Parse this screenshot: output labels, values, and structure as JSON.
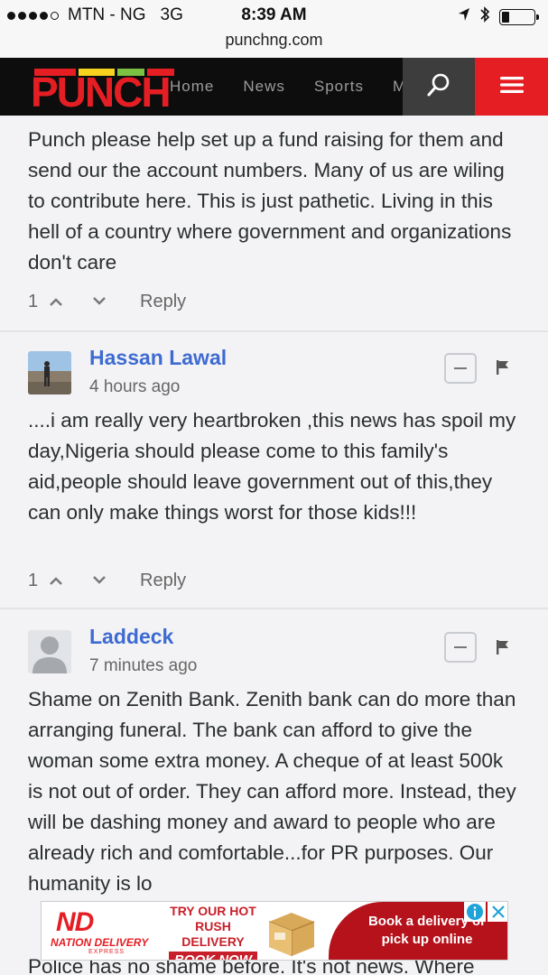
{
  "status_bar": {
    "carrier": "MTN - NG",
    "network": "3G",
    "time": "8:39 AM",
    "signal_bars": 4,
    "battery_level": 0.25
  },
  "url": "punchng.com",
  "site": {
    "logo_text": "PUNCH",
    "nav": [
      "Home",
      "News",
      "Sports",
      "M"
    ],
    "search_icon": "search-icon",
    "menu_icon": "hamburger-menu-icon",
    "logo_colors": [
      "#e51e24",
      "#f7d21e",
      "#7cc242",
      "#e51e24"
    ]
  },
  "comments": [
    {
      "text": "Punch please help set up a fund raising for them and send our the account numbers. Many of us are wiling to contribute here. This is just pathetic. Living in this hell of a country where government and organizations don't care",
      "votes": "1",
      "reply": "Reply"
    },
    {
      "author": "Hassan Lawal",
      "time": "4 hours ago",
      "text": "....i am really very heartbroken ,this news has spoil my day,Nigeria should please come to this family's aid,people should leave government out of this,they can only make things worst for those kids!!!",
      "votes": "1",
      "reply": "Reply"
    },
    {
      "author": "Laddeck",
      "time": "7 minutes ago",
      "text": "Shame on Zenith Bank. Zenith bank can do more than arranging funeral. The bank can afford to give the woman some extra money. A cheque of at least 500k is not out of order. They can afford more. Instead, they will be dashing money and award to people who are already rich and comfortable...for PR purposes. Our humanity is lo"
    },
    {
      "text": "Police has no shame before. It's not news. Where"
    }
  ],
  "ad": {
    "brand_mark": "ND",
    "brand_name": "NATION DELIVERY",
    "brand_sub": "EXPRESS",
    "line1": "TRY OUR HOT",
    "line2": "RUSH DELIVERY",
    "button": "BOOK NOW",
    "promo_line1": "Book a delivery or",
    "promo_line2": "pick up online"
  },
  "colors": {
    "accent_blue": "#3e6bd1",
    "punch_red": "#e51e24"
  }
}
